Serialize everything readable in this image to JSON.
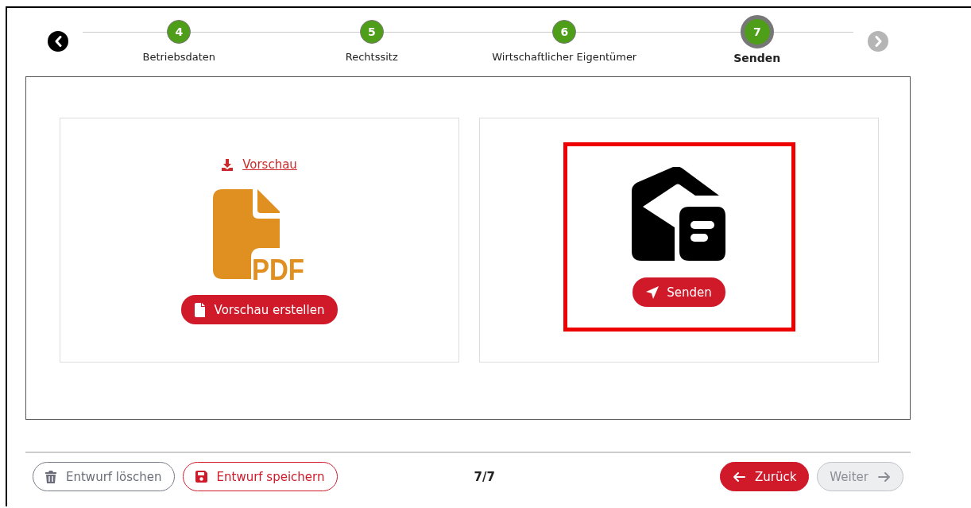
{
  "stepper": {
    "prev": {
      "disabled": false
    },
    "next": {
      "disabled": true
    },
    "steps": [
      {
        "number": "4",
        "label": "Betriebsdaten",
        "selected": false
      },
      {
        "number": "5",
        "label": "Rechtssitz",
        "selected": false
      },
      {
        "number": "6",
        "label": "Wirtschaftlicher Eigentümer",
        "selected": false
      },
      {
        "number": "7",
        "label": "Senden",
        "selected": true
      }
    ]
  },
  "preview_card": {
    "link": "Vorschau",
    "icon_label": "PDF",
    "button": "Vorschau erstellen"
  },
  "send_card": {
    "highlighted": true,
    "button": "Senden"
  },
  "footer": {
    "delete_button": "Entwurf löschen",
    "save_button": "Entwurf speichern",
    "page": "7/7",
    "back_button": {
      "label": "Zurück",
      "disabled": false
    },
    "next_button": {
      "label": "Weiter",
      "disabled": true
    }
  }
}
